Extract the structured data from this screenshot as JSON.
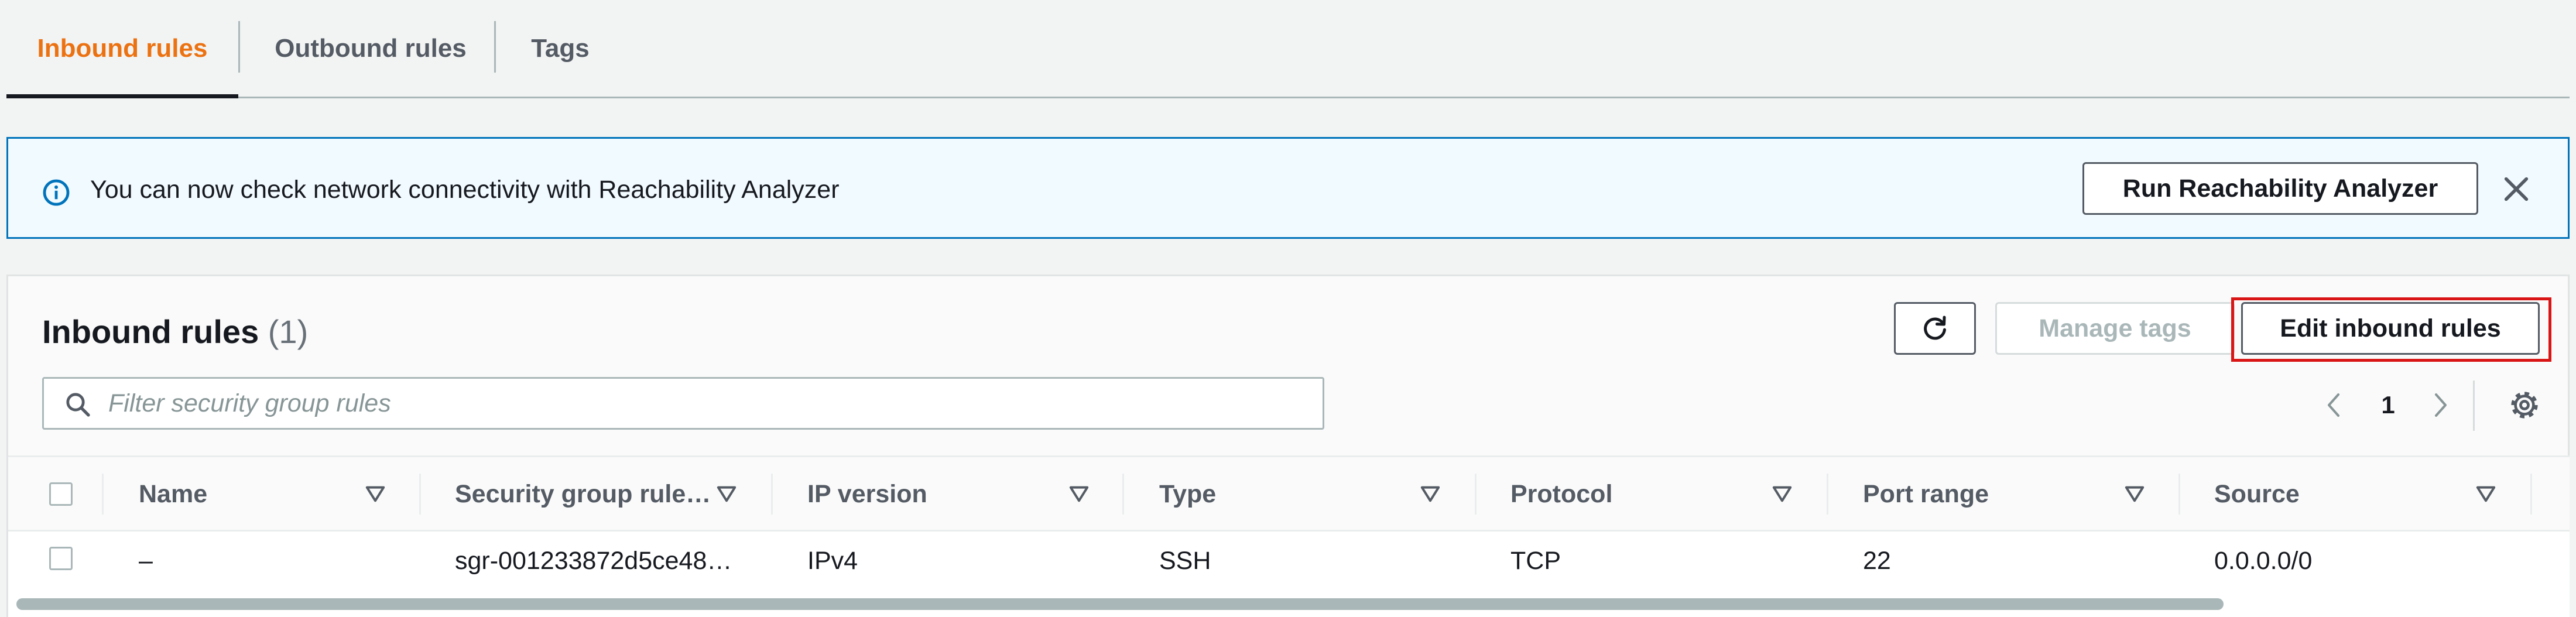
{
  "tabs": [
    {
      "label": "Inbound rules",
      "active": true
    },
    {
      "label": "Outbound rules",
      "active": false
    },
    {
      "label": "Tags",
      "active": false
    }
  ],
  "banner": {
    "icon": "info-icon",
    "message": "You can now check network connectivity with Reachability Analyzer",
    "button_label": "Run Reachability Analyzer",
    "close_icon": "close-icon"
  },
  "section": {
    "title": "Inbound rules",
    "count": "(1)",
    "refresh_icon": "refresh-icon",
    "manage_tags_label": "Manage tags",
    "edit_label": "Edit inbound rules"
  },
  "filter": {
    "placeholder": "Filter security group rules"
  },
  "pagination": {
    "current_page": "1"
  },
  "table": {
    "columns": [
      "Name",
      "Security group rule…",
      "IP version",
      "Type",
      "Protocol",
      "Port range",
      "Source"
    ],
    "rows": [
      {
        "name": "–",
        "rule_id": "sgr-001233872d5ce48…",
        "ip_version": "IPv4",
        "type": "SSH",
        "protocol": "TCP",
        "port_range": "22",
        "source": "0.0.0.0/0"
      }
    ]
  },
  "colors": {
    "active_tab": "#ec7211",
    "info_blue": "#0073bb",
    "banner_bg": "#f1faff",
    "highlight_red": "#d91515"
  }
}
